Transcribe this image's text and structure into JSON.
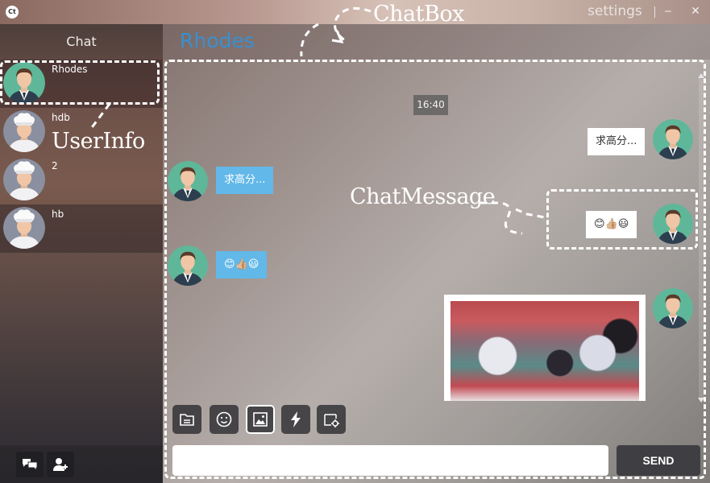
{
  "titlebar": {
    "logo_text": "Ct",
    "settings_label": "settings",
    "minimize_label": "‒",
    "close_label": "✕"
  },
  "sidebar": {
    "title": "Chat",
    "users": [
      {
        "name": "Rhodes",
        "avatar": "male-avatar",
        "state": "selected"
      },
      {
        "name": "hdb",
        "avatar": "chef-avatar"
      },
      {
        "name": "2",
        "avatar": "chef-avatar"
      },
      {
        "name": "hb",
        "avatar": "chef-avatar",
        "state": "hover"
      }
    ],
    "bottom_buttons": [
      "chat-bubbles-icon",
      "add-user-icon"
    ]
  },
  "chat": {
    "title": "Rhodes",
    "time": "16:40",
    "messages": [
      {
        "side": "right",
        "text": "求高分..."
      },
      {
        "side": "left",
        "text": "求高分..."
      },
      {
        "side": "right",
        "text": "😊👍🏼😃"
      },
      {
        "side": "left",
        "text": "😊👍🏼😃"
      },
      {
        "side": "right",
        "type": "image",
        "icon": "anime-image"
      }
    ]
  },
  "annotations": {
    "chatbox": "ChatBox",
    "userinfo": "UserInfo",
    "chatmessage": "ChatMessage"
  },
  "toolbar": {
    "buttons": [
      "file-icon",
      "emoji-icon",
      "image-icon",
      "lightning-icon",
      "screenshot-icon"
    ],
    "selected": "image-icon"
  },
  "input": {
    "value": "",
    "placeholder": "",
    "send_label": "SEND"
  },
  "colors": {
    "accent": "#3a8fd0",
    "bubble_left": "#62b8e8",
    "bubble_right": "#ffffff",
    "avatar_male_bg": "#5fb79a",
    "avatar_chef_bg": "#8a90a0"
  }
}
